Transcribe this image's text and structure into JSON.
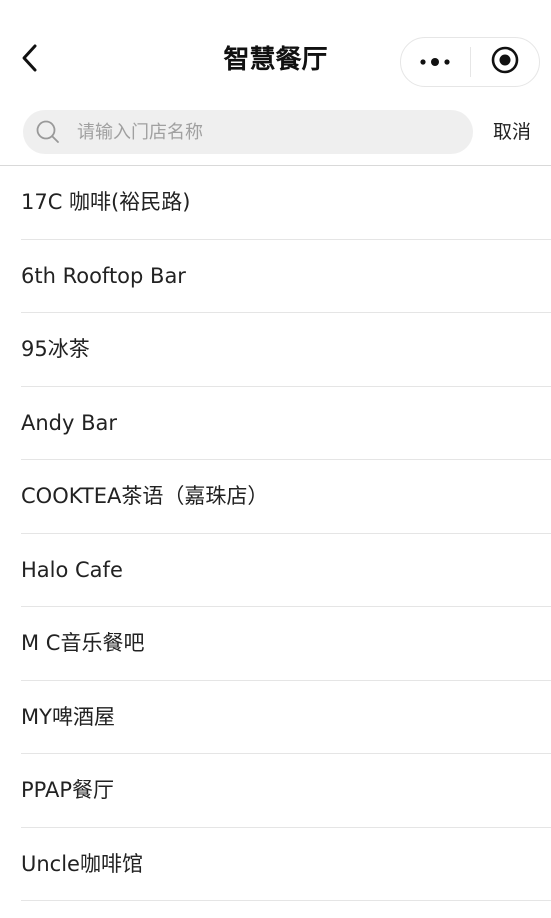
{
  "nav": {
    "title": "智慧餐厅",
    "back_icon": "chevron-left-icon",
    "more_icon": "more-dots-icon",
    "close_icon": "target-circle-icon"
  },
  "search": {
    "placeholder": "请输入门店名称",
    "value": "",
    "cancel_label": "取消",
    "icon": "search-icon"
  },
  "stores": [
    {
      "name": "17C 咖啡(裕民路)"
    },
    {
      "name": "6th Rooftop Bar"
    },
    {
      "name": "95冰茶"
    },
    {
      "name": "Andy Bar"
    },
    {
      "name": "COOKTEA茶语（嘉珠店）"
    },
    {
      "name": "Halo Cafe"
    },
    {
      "name": "M C音乐餐吧"
    },
    {
      "name": "MY啤酒屋"
    },
    {
      "name": "PPAP餐厅"
    },
    {
      "name": "Uncle咖啡馆"
    }
  ],
  "colors": {
    "search_bg": "#efefef",
    "divider": "#e5e5e5",
    "text": "#222222",
    "placeholder": "#a0a0a0"
  }
}
